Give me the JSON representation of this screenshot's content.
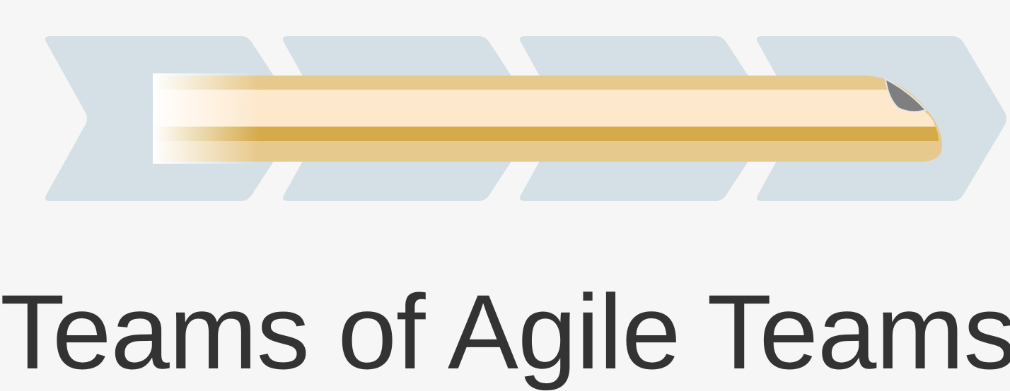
{
  "title": "Teams of Agile Teams",
  "colors": {
    "background": "#f6f6f6",
    "chevron": "#d4e0e5",
    "train_outer": "#e6c98c",
    "train_stripe_dark": "#d5ab4a",
    "train_body_light": "#fde8cc",
    "train_window": "#7f7f7f",
    "title_text": "#333333"
  },
  "chevron_count": 4,
  "icons": {
    "train": "train-icon",
    "chevron": "chevron-arrow-icon"
  }
}
